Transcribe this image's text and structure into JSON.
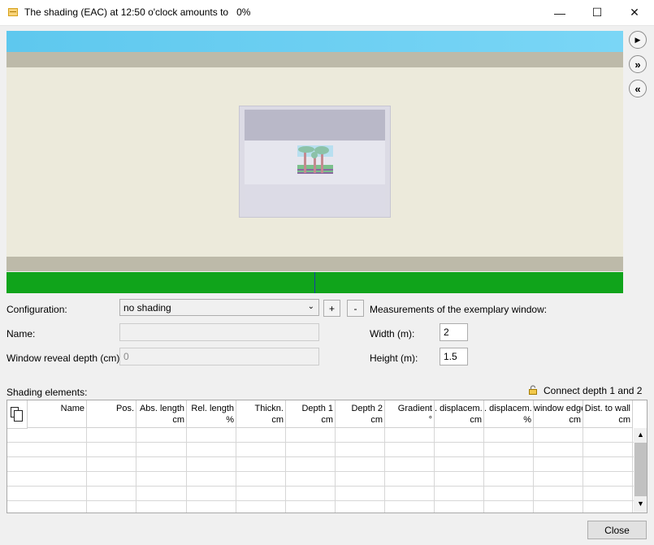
{
  "window": {
    "title": "The shading (EAC) at 12:50 o'clock amounts to   0%",
    "minimize_glyph": "—",
    "maximize_glyph": "☐",
    "close_glyph": "✕"
  },
  "side_buttons": {
    "play_glyph": "▶",
    "fast_forward_glyph": "»",
    "rewind_glyph": "«"
  },
  "form": {
    "configuration_label": "Configuration:",
    "configuration_value": "no shading",
    "add_label": "+",
    "remove_label": "-",
    "name_label": "Name:",
    "name_value": "",
    "reveal_label": "Window reveal depth (cm):",
    "reveal_value": "0",
    "measurements_label": "Measurements of the exemplary window:",
    "width_label": "Width (m):",
    "width_value": "2",
    "height_label": "Height (m):",
    "height_value": "1.5"
  },
  "shading": {
    "label": "Shading elements:",
    "connect_label": "Connect depth 1 and 2",
    "columns": [
      {
        "name": "Name",
        "unit": ""
      },
      {
        "name": "Pos.",
        "unit": ""
      },
      {
        "name": "Abs. length",
        "unit": "cm"
      },
      {
        "name": "Rel. length",
        "unit": "%"
      },
      {
        "name": "Thickn.",
        "unit": "cm"
      },
      {
        "name": "Depth 1",
        "unit": "cm"
      },
      {
        "name": "Depth 2",
        "unit": "cm"
      },
      {
        "name": "Gradient",
        "unit": "°"
      },
      {
        "name": ". displacem.",
        "unit": "cm"
      },
      {
        "name": ". displacem.",
        "unit": "%"
      },
      {
        "name": "window edge",
        "unit": "cm"
      },
      {
        "name": "Dist. to wall",
        "unit": "cm"
      }
    ]
  },
  "footer": {
    "close_label": "Close"
  },
  "colors": {
    "sky": "#6ccff3",
    "wall": "#eceadb",
    "ground": "#10a41b"
  }
}
